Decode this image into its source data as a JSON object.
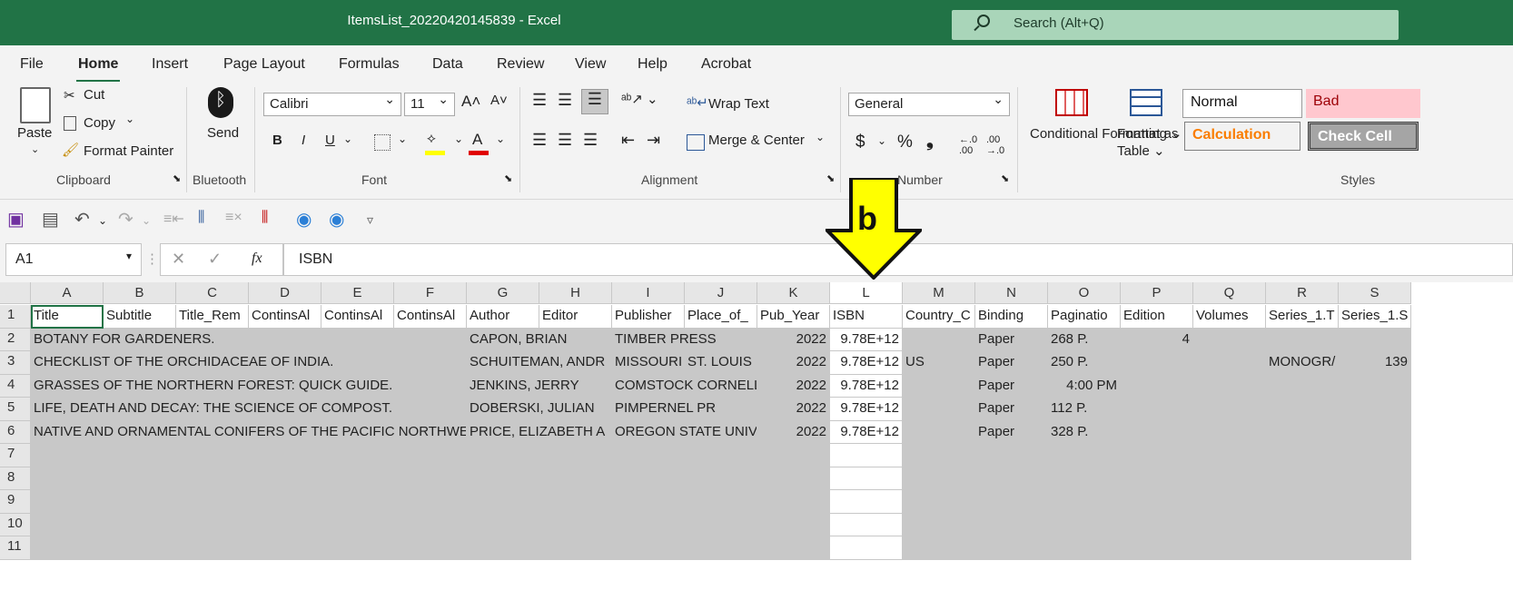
{
  "titlebar": {
    "title": "ItemsList_20220420145839  -  Excel",
    "search_placeholder": "Search (Alt+Q)"
  },
  "menu": [
    "File",
    "Home",
    "Insert",
    "Page Layout",
    "Formulas",
    "Data",
    "Review",
    "View",
    "Help",
    "Acrobat"
  ],
  "ribbon": {
    "clipboard": {
      "paste": "Paste",
      "cut": "Cut",
      "copy": "Copy",
      "format_painter": "Format Painter",
      "label": "Clipboard"
    },
    "bluetooth": {
      "send": "Send",
      "label": "Bluetooth"
    },
    "font": {
      "name": "Calibri",
      "size": "11",
      "bold": "B",
      "italic": "I",
      "underline": "U",
      "grow": "A˄",
      "shrink": "A˅",
      "label": "Font"
    },
    "alignment": {
      "wrap_text": "Wrap Text",
      "merge_center": "Merge & Center",
      "label": "Alignment"
    },
    "number": {
      "format": "General",
      "currency": "$",
      "percent": "%",
      "comma": "❟",
      "label": "Number"
    },
    "styles": {
      "conditional": "Conditional Formatting",
      "format_table": "Format as Table",
      "normal": "Normal",
      "bad": "Bad",
      "calculation": "Calculation",
      "check_cell": "Check Cell",
      "label": "Styles"
    }
  },
  "formula_bar": {
    "name_box": "A1",
    "fx": "fx",
    "formula": "ISBN"
  },
  "annotation": {
    "label": "b"
  },
  "grid": {
    "columns": [
      "A",
      "B",
      "C",
      "D",
      "E",
      "F",
      "G",
      "H",
      "I",
      "J",
      "K",
      "L",
      "M",
      "N",
      "O",
      "P",
      "Q",
      "R",
      "S"
    ],
    "rows": [
      {
        "num": "1",
        "cells": [
          {
            "col": 0,
            "text": "Title"
          },
          {
            "col": 1,
            "text": "Subtitle"
          },
          {
            "col": 2,
            "text": "Title_Rem"
          },
          {
            "col": 3,
            "text": "ContinsAl"
          },
          {
            "col": 4,
            "text": "ContinsAl"
          },
          {
            "col": 5,
            "text": "ContinsAl"
          },
          {
            "col": 6,
            "text": "Author"
          },
          {
            "col": 7,
            "text": "Editor"
          },
          {
            "col": 8,
            "text": "Publisher"
          },
          {
            "col": 9,
            "text": "Place_of_"
          },
          {
            "col": 10,
            "text": "Pub_Year"
          },
          {
            "col": 11,
            "text": "ISBN"
          },
          {
            "col": 12,
            "text": "Country_C"
          },
          {
            "col": 13,
            "text": "Binding"
          },
          {
            "col": 14,
            "text": "Paginatio"
          },
          {
            "col": 15,
            "text": "Edition"
          },
          {
            "col": 16,
            "text": "Volumes"
          },
          {
            "col": 17,
            "text": "Series_1.T"
          },
          {
            "col": 18,
            "text": "Series_1.S"
          }
        ]
      },
      {
        "num": "2",
        "cells": [
          {
            "col": 0,
            "span": 6,
            "text": "BOTANY FOR GARDENERS."
          },
          {
            "col": 6,
            "span": 2,
            "text": "CAPON, BRIAN"
          },
          {
            "col": 8,
            "span": 2,
            "text": "TIMBER PRESS"
          },
          {
            "col": 10,
            "text": "2022",
            "num": true
          },
          {
            "col": 11,
            "text": "9.78E+12",
            "num": true
          },
          {
            "col": 13,
            "text": "Paper"
          },
          {
            "col": 14,
            "text": "268 P."
          },
          {
            "col": 15,
            "text": "4",
            "num": true
          }
        ]
      },
      {
        "num": "3",
        "cells": [
          {
            "col": 0,
            "span": 6,
            "text": "CHECKLIST OF THE ORCHIDACEAE OF INDIA."
          },
          {
            "col": 6,
            "span": 2,
            "text": "SCHUITEMAN, ANDR"
          },
          {
            "col": 8,
            "text": "MISSOURI"
          },
          {
            "col": 9,
            "text": "ST. LOUIS"
          },
          {
            "col": 10,
            "text": "2022",
            "num": true
          },
          {
            "col": 11,
            "text": "9.78E+12",
            "num": true
          },
          {
            "col": 12,
            "text": "US"
          },
          {
            "col": 13,
            "text": "Paper"
          },
          {
            "col": 14,
            "text": "250 P."
          },
          {
            "col": 17,
            "text": "MONOGR/"
          },
          {
            "col": 18,
            "text": "139",
            "num": true
          }
        ]
      },
      {
        "num": "4",
        "cells": [
          {
            "col": 0,
            "span": 6,
            "text": "GRASSES OF THE NORTHERN FOREST: QUICK GUIDE."
          },
          {
            "col": 6,
            "span": 2,
            "text": "JENKINS, JERRY"
          },
          {
            "col": 8,
            "span": 2,
            "text": "COMSTOCK CORNELL"
          },
          {
            "col": 10,
            "text": "2022",
            "num": true
          },
          {
            "col": 11,
            "text": "9.78E+12",
            "num": true
          },
          {
            "col": 13,
            "text": "Paper"
          },
          {
            "col": 14,
            "text": "4:00 PM",
            "num": true
          }
        ]
      },
      {
        "num": "5",
        "cells": [
          {
            "col": 0,
            "span": 6,
            "text": "LIFE, DEATH AND DECAY: THE SCIENCE OF COMPOST."
          },
          {
            "col": 6,
            "span": 2,
            "text": "DOBERSKI, JULIAN"
          },
          {
            "col": 8,
            "span": 2,
            "text": "PIMPERNEL PR"
          },
          {
            "col": 10,
            "text": "2022",
            "num": true
          },
          {
            "col": 11,
            "text": "9.78E+12",
            "num": true
          },
          {
            "col": 13,
            "text": "Paper"
          },
          {
            "col": 14,
            "text": "112 P."
          }
        ]
      },
      {
        "num": "6",
        "cells": [
          {
            "col": 0,
            "span": 6,
            "text": "NATIVE AND ORNAMENTAL CONIFERS OF THE PACIFIC NORTHWEST"
          },
          {
            "col": 6,
            "span": 2,
            "text": "PRICE, ELIZABETH A"
          },
          {
            "col": 8,
            "span": 2,
            "text": "OREGON STATE UNIV"
          },
          {
            "col": 10,
            "text": "2022",
            "num": true
          },
          {
            "col": 11,
            "text": "9.78E+12",
            "num": true
          },
          {
            "col": 13,
            "text": "Paper"
          },
          {
            "col": 14,
            "text": "328 P."
          }
        ]
      },
      {
        "num": "7",
        "cells": []
      },
      {
        "num": "8",
        "cells": []
      },
      {
        "num": "9",
        "cells": []
      },
      {
        "num": "10",
        "cells": []
      },
      {
        "num": "11",
        "cells": []
      }
    ]
  }
}
